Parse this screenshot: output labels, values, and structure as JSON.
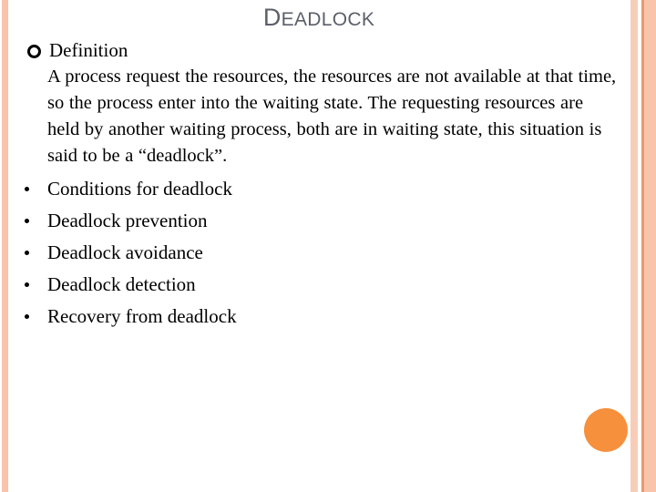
{
  "slide": {
    "title_first_letter": "D",
    "title_rest": "EADLOCK",
    "title_full": "DEADLOCK",
    "background_color": "#ffffff",
    "title_color": "#5b6069"
  },
  "decoration": {
    "left_stripe_color": "#f7c3ab",
    "right_stripe_a_color": "#f8cdb8",
    "right_stripe_line_color": "#e79b6d",
    "right_stripe_b_color": "#fac4ab",
    "accent_circle_color": "#f7903d"
  },
  "body": {
    "definition_heading": "Definition",
    "definition_text": "A process request the resources, the resources are not available at that time, so the process enter into the waiting state. The requesting resources are held by another waiting process, both are in waiting state, this situation is said to be a “deadlock”.",
    "topics": [
      "Conditions for deadlock",
      "Deadlock prevention",
      "Deadlock avoidance",
      "Deadlock detection",
      "Recovery from deadlock"
    ]
  }
}
